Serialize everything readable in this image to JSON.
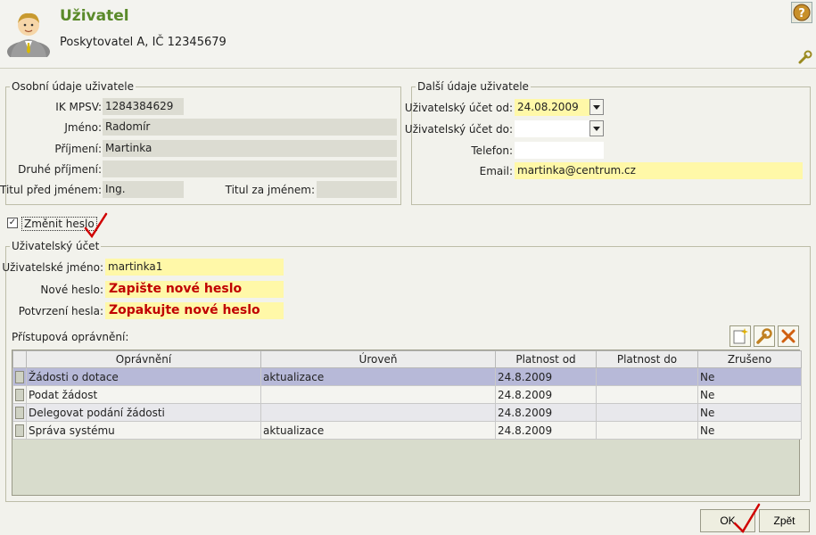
{
  "header": {
    "title": "Uživatel",
    "subtitle": "Poskytovatel A, IČ 12345679"
  },
  "personal": {
    "legend": "Osobní údaje uživatele",
    "ik_label": "IK MPSV:",
    "ik_value": "1284384629",
    "first_label": "Jméno:",
    "first_value": "Radomír",
    "last_label": "Příjmení:",
    "last_value": "Martinka",
    "last2_label": "Druhé příjmení:",
    "last2_value": "",
    "title_before_label": "Titul před jménem:",
    "title_before_value": "Ing.",
    "title_after_label": "Titul za jménem:",
    "title_after_value": ""
  },
  "other": {
    "legend": "Další údaje uživatele",
    "from_label": "Uživatelský účet od:",
    "from_value": "24.08.2009",
    "to_label": "Uživatelský účet do:",
    "to_value": "",
    "phone_label": "Telefon:",
    "phone_value": "",
    "email_label": "Email:",
    "email_value": "martinka@centrum.cz"
  },
  "change_password": {
    "label": "Změnit heslo",
    "checked": true
  },
  "account": {
    "legend": "Uživatelský účet",
    "username_label": "Uživatelské jméno:",
    "username_value": "martinka1",
    "new_pw_label": "Nové heslo:",
    "new_pw_value": "Zapište nové heslo",
    "confirm_label": "Potvrzení hesla:",
    "confirm_value": "Zopakujte nové heslo",
    "permissions_label": "Přístupová oprávnění:"
  },
  "toolbar_icons": [
    "new-item-icon",
    "edit-wrench-icon",
    "delete-icon"
  ],
  "grid": {
    "columns": [
      "Oprávnění",
      "Úroveň",
      "Platnost od",
      "Platnost do",
      "Zrušeno"
    ],
    "rows": [
      {
        "name": "Žádosti o dotace",
        "level": "aktualizace",
        "from": "24.8.2009",
        "to": "",
        "cancelled": "Ne"
      },
      {
        "name": "Podat žádost",
        "level": "",
        "from": "24.8.2009",
        "to": "",
        "cancelled": "Ne"
      },
      {
        "name": "Delegovat podání žádosti",
        "level": "",
        "from": "24.8.2009",
        "to": "",
        "cancelled": "Ne"
      },
      {
        "name": "Správa systému",
        "level": "aktualizace",
        "from": "24.8.2009",
        "to": "",
        "cancelled": "Ne"
      }
    ]
  },
  "buttons": {
    "ok": "OK",
    "back": "Zpět"
  },
  "colors": {
    "accent_green": "#5a8a2a",
    "required_yellow": "#fff8a8",
    "selected_row": "#b7b9d8",
    "check_red": "#d00000"
  }
}
